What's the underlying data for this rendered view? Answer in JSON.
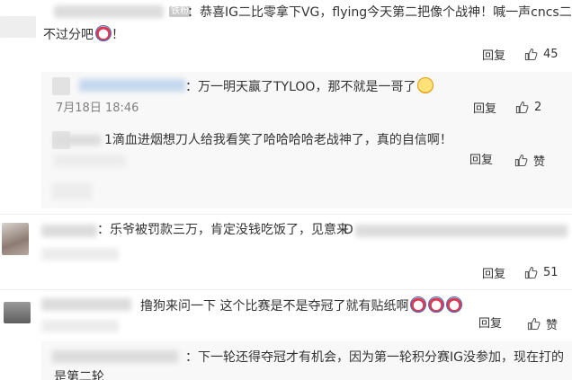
{
  "comments": [
    {
      "fan_badge": "铁粉",
      "text": "：恭喜IG二比零拿下VG，flying今天第二把像个战神！喊一声cncs二哥",
      "text_line2": "不过分吧",
      "text_line2_suffix": "！",
      "reply_label": "回复",
      "likes": "45"
    },
    {
      "text": "：万一明天赢了TYLOO，那不就是一哥了",
      "time": "7月18日 18:46",
      "reply_label": "回复",
      "likes": "2"
    },
    {
      "text": "1滴血进烟想刀人给我看笑了哈哈哈哈老战神了，真的自信啊！",
      "reply_label": "回复",
      "likes": "赞"
    },
    {
      "text": "：乐爷被罚款三万，肯定没钱吃饭了，见意来",
      "text_tail": "D",
      "reply_label": "回复",
      "likes": "51"
    },
    {
      "text": "撸狗来问一下 这个比赛是不是夺冠了就有贴纸啊",
      "reply_label": "回复",
      "likes": "赞"
    },
    {
      "text": "：下一轮还得夺冠才有机会，因为第一轮积分赛IG没参加，现在打的",
      "text_line2": "是第二轮"
    }
  ],
  "icons": {
    "like": "thumbs-up-icon",
    "emoji_cat": "cat-face-emoji-icon",
    "emoji_smile": "smiling-face-emoji-icon"
  },
  "colors": {
    "text": "#333333",
    "meta": "#808080",
    "divider": "#efefef"
  }
}
